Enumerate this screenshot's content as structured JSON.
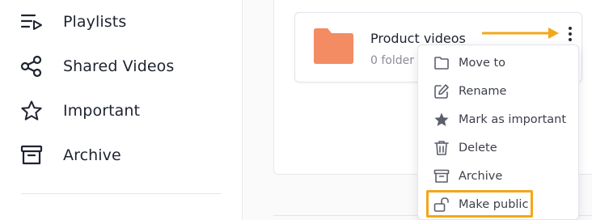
{
  "sidebar": {
    "items": [
      {
        "label": "Playlists",
        "icon": "playlist-icon"
      },
      {
        "label": "Shared Videos",
        "icon": "share-icon"
      },
      {
        "label": "Important",
        "icon": "star-icon"
      },
      {
        "label": "Archive",
        "icon": "archive-icon"
      }
    ]
  },
  "folder": {
    "name": "Product videos",
    "meta": "0 folder",
    "color": "#F38B63"
  },
  "menu": {
    "items": [
      {
        "label": "Move to",
        "icon": "folder-outline-icon"
      },
      {
        "label": "Rename",
        "icon": "edit-icon"
      },
      {
        "label": "Mark as important",
        "icon": "star-filled-icon"
      },
      {
        "label": "Delete",
        "icon": "trash-icon"
      },
      {
        "label": "Archive",
        "icon": "archive-icon"
      },
      {
        "label": "Make public",
        "icon": "unlock-icon"
      }
    ]
  },
  "colors": {
    "accent": "#F3A71B",
    "text": "#1F2330",
    "muted": "#8A8D98"
  }
}
